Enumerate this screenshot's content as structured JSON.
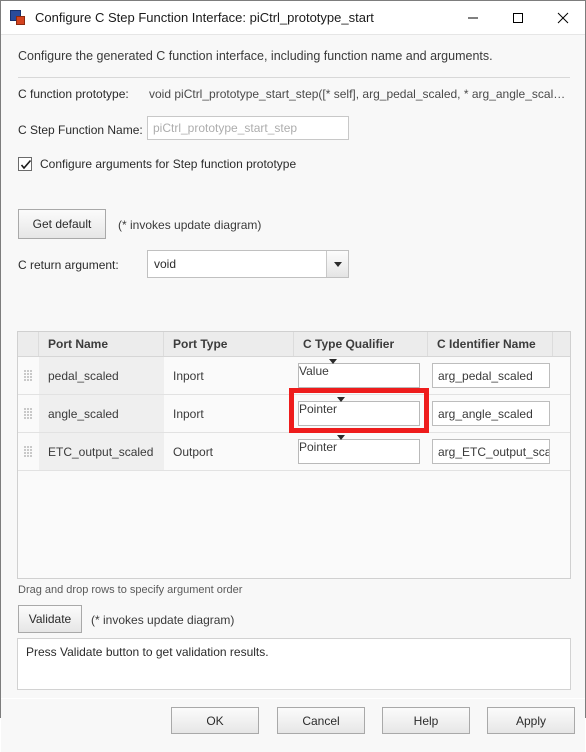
{
  "window": {
    "title": "Configure C Step Function Interface: piCtrl_prototype_start",
    "icon": "simulink-app-icon",
    "controls": {
      "minimize": "minimize-icon",
      "maximize": "maximize-icon",
      "close": "close-icon"
    }
  },
  "intro": "Configure the generated C function interface, including function name and arguments.",
  "fields": {
    "prototype_label": "C function prototype:",
    "prototype_value": "void piCtrl_prototype_start_step([* self], arg_pedal_scaled, * arg_angle_scal…",
    "step_name_label": "C Step Function Name:",
    "step_name_value": "piCtrl_prototype_start_step",
    "step_name_is_placeholder": true,
    "checkbox_label": "Configure arguments for Step function prototype",
    "checkbox_checked": true,
    "get_default_label": "Get default",
    "get_default_note": "(* invokes update diagram)",
    "return_arg_label": "C return argument:",
    "return_arg_value": "void"
  },
  "table": {
    "columns": [
      "",
      "Port Name",
      "Port Type",
      "C Type Qualifier",
      "C Identifier Name",
      ""
    ],
    "rows": [
      {
        "handle": "drag-handle-icon",
        "port_name": "pedal_scaled",
        "port_type": "Inport",
        "type_qualifier": "Value",
        "qualifier_disabled": false,
        "identifier": "arg_pedal_scaled"
      },
      {
        "handle": "drag-handle-icon",
        "port_name": "angle_scaled",
        "port_type": "Inport",
        "type_qualifier": "Pointer",
        "qualifier_disabled": false,
        "identifier": "arg_angle_scaled"
      },
      {
        "handle": "drag-handle-icon",
        "port_name": "ETC_output_scaled",
        "port_type": "Outport",
        "type_qualifier": "Pointer",
        "qualifier_disabled": true,
        "identifier": "arg_ETC_output_sca"
      }
    ],
    "drag_note": "Drag and drop rows to specify argument order"
  },
  "highlight": {
    "name": "red-highlight-box",
    "color": "#ee1c1c",
    "target": "C Type Qualifier dropdown of angle_scaled row"
  },
  "validate": {
    "button_label": "Validate",
    "note": "(* invokes update diagram)",
    "results_text": "Press Validate button to get validation results."
  },
  "footer": {
    "ok": "OK",
    "cancel": "Cancel",
    "help": "Help",
    "apply": "Apply"
  }
}
